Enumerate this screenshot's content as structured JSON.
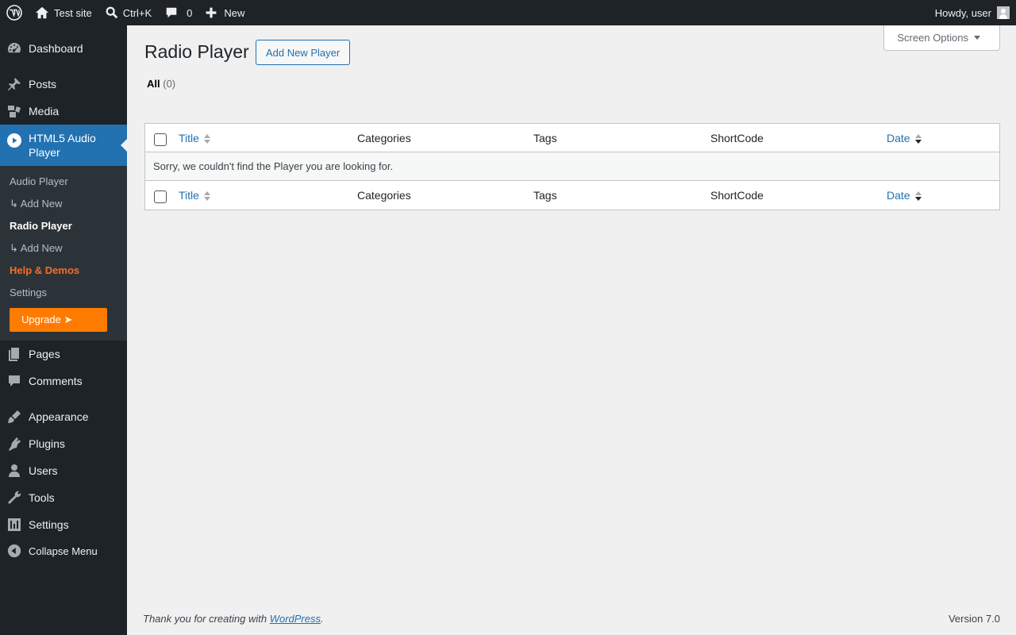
{
  "admin_bar": {
    "site_name": "Test site",
    "search_shortcut": "Ctrl+K",
    "comments_count": "0",
    "new_label": "New",
    "greeting": "Howdy, user"
  },
  "sidebar": {
    "dashboard": "Dashboard",
    "posts": "Posts",
    "media": "Media",
    "current": "HTML5 Audio Player",
    "submenu": {
      "audio_player": "Audio Player",
      "add_new_1": "↳ Add New",
      "radio_player": "Radio Player",
      "add_new_2": "↳ Add New",
      "help_demos": "Help & Demos",
      "settings": "Settings",
      "upgrade": "Upgrade ➤"
    },
    "pages": "Pages",
    "comments": "Comments",
    "appearance": "Appearance",
    "plugins": "Plugins",
    "users": "Users",
    "tools": "Tools",
    "settings": "Settings",
    "collapse": "Collapse Menu"
  },
  "main": {
    "title": "Radio Player",
    "add_new_button": "Add New Player",
    "screen_options": "Screen Options",
    "filter_all": "All",
    "filter_count": "(0)",
    "columns": {
      "title": "Title",
      "categories": "Categories",
      "tags": "Tags",
      "shortcode": "ShortCode",
      "date": "Date"
    },
    "empty_message": "Sorry, we couldn't find the Player you are looking for."
  },
  "footer": {
    "thanks_prefix": "Thank you for creating with ",
    "thanks_link": "WordPress",
    "thanks_suffix": ".",
    "version": "Version 7.0"
  },
  "colors": {
    "admin_bg": "#1d2327",
    "accent": "#2271b1",
    "upgrade": "#ff7b00",
    "help": "#f56e28"
  }
}
